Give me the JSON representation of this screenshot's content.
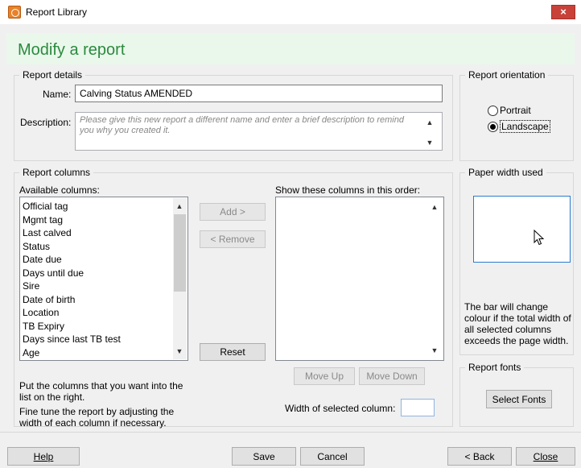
{
  "window": {
    "title": "Report Library",
    "close_symbol": "×"
  },
  "header": {
    "title": "Modify a report"
  },
  "report_details": {
    "legend": "Report details",
    "name_label": "Name:",
    "name_value": "Calving Status AMENDED",
    "description_label": "Description:",
    "description_placeholder": "Please give this new report a different name and enter a brief description to remind you why you created it."
  },
  "orientation": {
    "legend": "Report orientation",
    "options": [
      {
        "label": "Portrait",
        "selected": false
      },
      {
        "label": "Landscape",
        "selected": true
      }
    ]
  },
  "report_columns": {
    "legend": "Report columns",
    "available_label": "Available columns:",
    "available": [
      "Official tag",
      "Mgmt tag",
      "Last calved",
      "Status",
      "Date due",
      "Days until due",
      "Sire",
      "Date of birth",
      "Location",
      "TB Expiry",
      "Days since last TB test",
      "Age"
    ],
    "add_label": "Add >",
    "remove_label": "< Remove",
    "reset_label": "Reset",
    "show_label": "Show these columns in this order:",
    "show": [],
    "move_up_label": "Move Up",
    "move_down_label": "Move Down",
    "width_label": "Width of selected column:",
    "width_value": "",
    "help1": "Put the columns that you want into the list on the right.",
    "help2": "Fine tune the report by adjusting the width of each column if necessary."
  },
  "paper_width": {
    "legend": "Paper width used",
    "note": "The bar will change colour if the total width of all selected columns exceeds the page width."
  },
  "report_fonts": {
    "legend": "Report fonts",
    "select_label": "Select Fonts"
  },
  "footer": {
    "help_label": "Help",
    "save_label": "Save",
    "cancel_label": "Cancel",
    "back_label": "< Back",
    "close_label": "Close"
  }
}
